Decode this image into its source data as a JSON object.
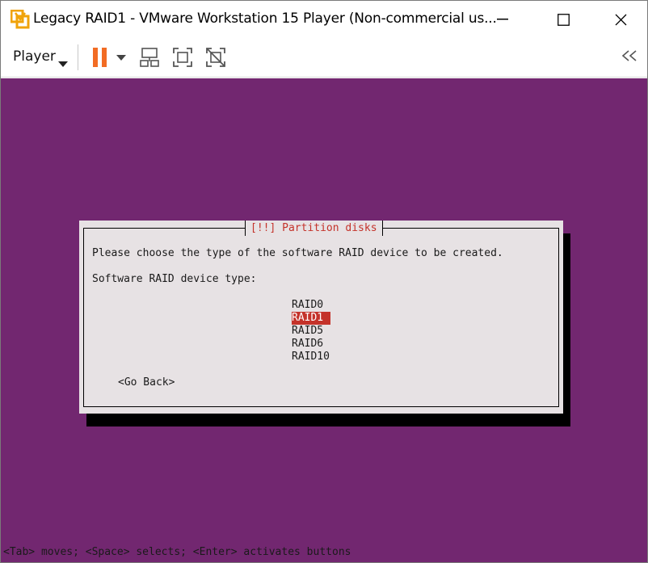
{
  "window": {
    "title": "Legacy RAID1 - VMware Workstation 15 Player (Non-commercial us..."
  },
  "toolbar": {
    "player_label": "Player",
    "icons": [
      "pause-icon",
      "dropdown-caret-icon",
      "send-ctrl-alt-del-icon",
      "fullscreen-icon",
      "unity-icon",
      "collapse-icon"
    ],
    "accent_color": "#f26c24"
  },
  "installer": {
    "dialog_title": "[!!] Partition disks",
    "question": "Please choose the type of the software RAID device to be created.",
    "field_label": "Software RAID device type:",
    "options": [
      "RAID0",
      "RAID1",
      "RAID5",
      "RAID6",
      "RAID10"
    ],
    "selected_option": "RAID1",
    "go_back": "<Go Back>",
    "status_hint": "<Tab> moves; <Space> selects; <Enter> activates buttons"
  },
  "colors": {
    "vm_background": "#722770",
    "dialog_background": "#e7e2e4",
    "title_text": "#c4322a",
    "selection": "#c4322a"
  }
}
